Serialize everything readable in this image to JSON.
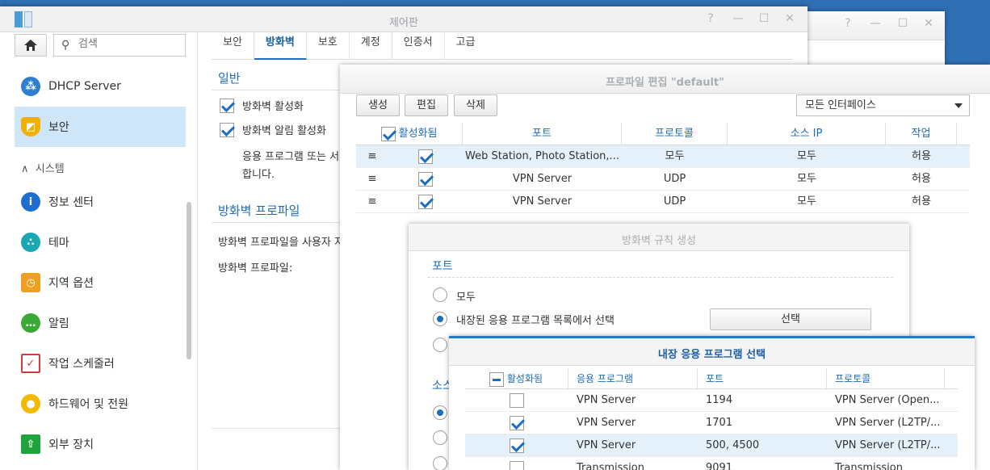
{
  "back_window": {
    "controls": [
      "?",
      "—",
      "☐",
      "✕"
    ]
  },
  "control_panel": {
    "title": "제어판",
    "controls": [
      "?",
      "—",
      "☐",
      "✕"
    ],
    "search": {
      "placeholder": "검색"
    },
    "sidebar": {
      "items": [
        {
          "label": "DHCP Server",
          "icon": "network-icon"
        },
        {
          "label": "보안",
          "icon": "shield-icon"
        },
        {
          "label": "정보 센터",
          "icon": "info-icon"
        },
        {
          "label": "테마",
          "icon": "palette-icon"
        },
        {
          "label": "지역 옵션",
          "icon": "map-clock-icon"
        },
        {
          "label": "알림",
          "icon": "chat-icon"
        },
        {
          "label": "작업 스케줄러",
          "icon": "calendar-check-icon"
        },
        {
          "label": "하드웨어 및 전원",
          "icon": "bulb-icon"
        },
        {
          "label": "외부 장치",
          "icon": "upload-icon"
        }
      ],
      "section_system": "시스템"
    },
    "tabs": [
      "보안",
      "방화벽",
      "보호",
      "계정",
      "인증서",
      "고급"
    ],
    "general_title": "일반",
    "enable_firewall": "방화벽 활성화",
    "enable_firewall_notify": "방화벽 알림 활성화",
    "general_desc_1": "응용 프로그램 또는 서",
    "general_desc_2": "합니다.",
    "profile_title": "방화벽 프로파일",
    "profile_desc": "방화벽 프로파일을 사용자 지",
    "profile_label": "방화벽 프로파일:"
  },
  "profile_edit": {
    "title": "프로파일 편집 \"default\"",
    "buttons": {
      "create": "생성",
      "edit": "편집",
      "delete": "삭제"
    },
    "interface_select": "모든 인터페이스",
    "columns": [
      "활성화됨",
      "포트",
      "프로토콜",
      "소스 IP",
      "작업"
    ],
    "rows": [
      {
        "port": "Web Station, Photo Station,...",
        "protocol": "모두",
        "source": "모두",
        "action": "허용"
      },
      {
        "port": "VPN Server",
        "protocol": "UDP",
        "source": "모두",
        "action": "허용"
      },
      {
        "port": "VPN Server",
        "protocol": "UDP",
        "source": "모두",
        "action": "허용"
      }
    ]
  },
  "rule_create": {
    "title": "방화벽 규칙 생성",
    "port_title": "포트",
    "opt_all": "모두",
    "opt_builtin": "내장된 응용 프로그램 목록에서 선택",
    "select_button": "선택",
    "source_title": "소스"
  },
  "app_select": {
    "title": "내장 응용 프로그램 선택",
    "columns": [
      "활성화됨",
      "응용 프로그램",
      "포트",
      "프로토콜"
    ],
    "rows": [
      {
        "checked": false,
        "app": "VPN Server",
        "port": "1194",
        "protocol": "VPN Server (Open..."
      },
      {
        "checked": true,
        "app": "VPN Server",
        "port": "1701",
        "protocol": "VPN Server (L2TP/..."
      },
      {
        "checked": true,
        "app": "VPN Server",
        "port": "500, 4500",
        "protocol": "VPN Server (L2TP/..."
      },
      {
        "checked": false,
        "app": "Transmission",
        "port": "9091",
        "protocol": "Transmission"
      }
    ]
  }
}
